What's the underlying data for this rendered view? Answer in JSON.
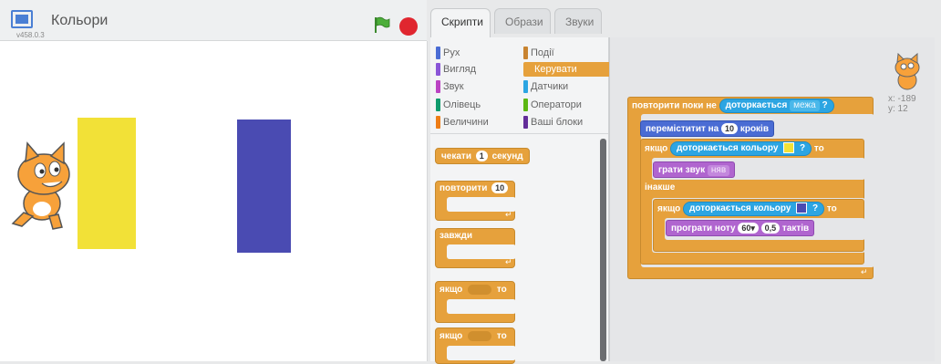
{
  "stage": {
    "title": "Кольори",
    "version": "v458.0.3"
  },
  "tabs": [
    {
      "label": "Скрипти"
    },
    {
      "label": "Образи"
    },
    {
      "label": "Звуки"
    }
  ],
  "categories": [
    {
      "label": "Рух",
      "color": "#4a6cd4"
    },
    {
      "label": "Вигляд",
      "color": "#8a55d7"
    },
    {
      "label": "Звук",
      "color": "#bb42c3"
    },
    {
      "label": "Олівець",
      "color": "#0e9a6c"
    },
    {
      "label": "Величини",
      "color": "#ee7d16"
    },
    {
      "label": "Події",
      "color": "#c88330"
    },
    {
      "label": "Керувати",
      "color": "#e6a13c"
    },
    {
      "label": "Датчики",
      "color": "#2ca5e2"
    },
    {
      "label": "Оператори",
      "color": "#5cb712"
    },
    {
      "label": "Ваші блоки",
      "color": "#632d99"
    }
  ],
  "palette": {
    "wait": {
      "pre": "чекати",
      "num": "1",
      "post": "секунд"
    },
    "repeat": {
      "pre": "повторити",
      "num": "10"
    },
    "forever": {
      "label": "завжди"
    },
    "if1": {
      "pre": "якщо",
      "post": "то"
    },
    "if2": {
      "pre": "якщо",
      "post": "то"
    }
  },
  "script": {
    "repeat_until": {
      "pre": "повторити поки не",
      "sense": "доторкається",
      "dd": "межа"
    },
    "move": {
      "pre": "переміститит на",
      "num": "10",
      "post": "кроків"
    },
    "if": {
      "pre": "якщо",
      "sense": "доторкається кольору",
      "q": "?",
      "post": "то"
    },
    "play_sound": {
      "pre": "грати звук",
      "dd": "няв"
    },
    "else": {
      "label": "інакше"
    },
    "if_inner": {
      "pre": "якщо",
      "sense": "доторкається кольору",
      "q": "?",
      "post": "то"
    },
    "play_note": {
      "pre": "програти ноту",
      "note": "60▾",
      "beats": "0,5",
      "post": "тактів"
    },
    "q_mark": "?"
  },
  "colors": {
    "yellow": "#f2e137",
    "blue": "#4a4bb2"
  },
  "sprite_coords": {
    "x": "x: -189",
    "y": "y: 12"
  }
}
